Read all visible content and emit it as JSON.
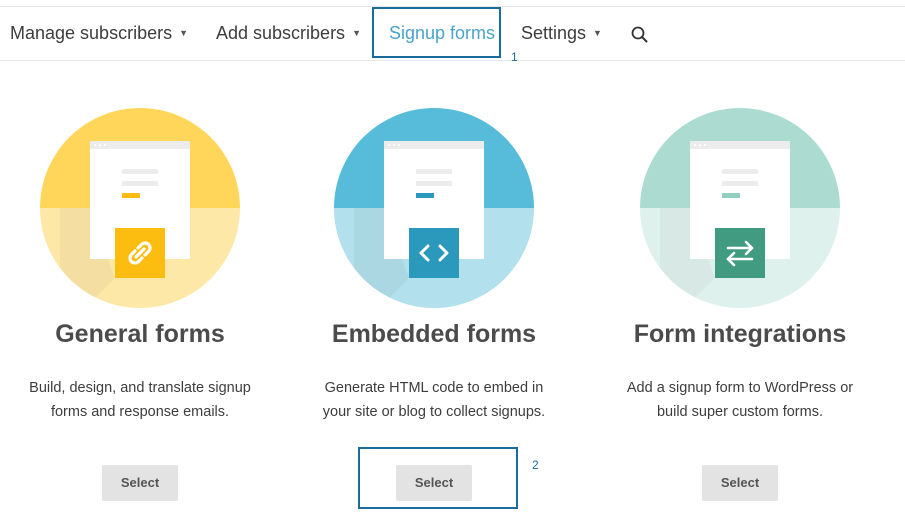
{
  "nav": {
    "items": [
      {
        "label": "Manage subscribers",
        "has_caret": true
      },
      {
        "label": "Add subscribers",
        "has_caret": true
      },
      {
        "label": "Signup forms",
        "has_caret": false,
        "active": true
      },
      {
        "label": "Settings",
        "has_caret": true
      }
    ],
    "caret_glyph": "▼",
    "search_icon": "search-icon"
  },
  "annotations": {
    "marker_1": "1",
    "marker_2": "2"
  },
  "cards": [
    {
      "title": "General forms",
      "description": "Build, design, and translate signup forms and response emails.",
      "button_label": "Select",
      "icon": "link-icon",
      "colors": {
        "top": "#ffd55a",
        "bottom": "#fee8a8",
        "badge": "#fdbd10"
      }
    },
    {
      "title": "Embedded forms",
      "description": "Generate HTML code to embed in your site or blog to collect signups.",
      "button_label": "Select",
      "icon": "code-icon",
      "colors": {
        "top": "#56bcd9",
        "bottom": "#b2e0ec",
        "badge": "#2a99bb"
      }
    },
    {
      "title": "Form integrations",
      "description": "Add a signup form to WordPress or build super custom forms.",
      "button_label": "Select",
      "icon": "swap-arrows-icon",
      "colors": {
        "top": "#acdcd1",
        "bottom": "#dff1ed",
        "badge": "#419b80"
      }
    }
  ]
}
